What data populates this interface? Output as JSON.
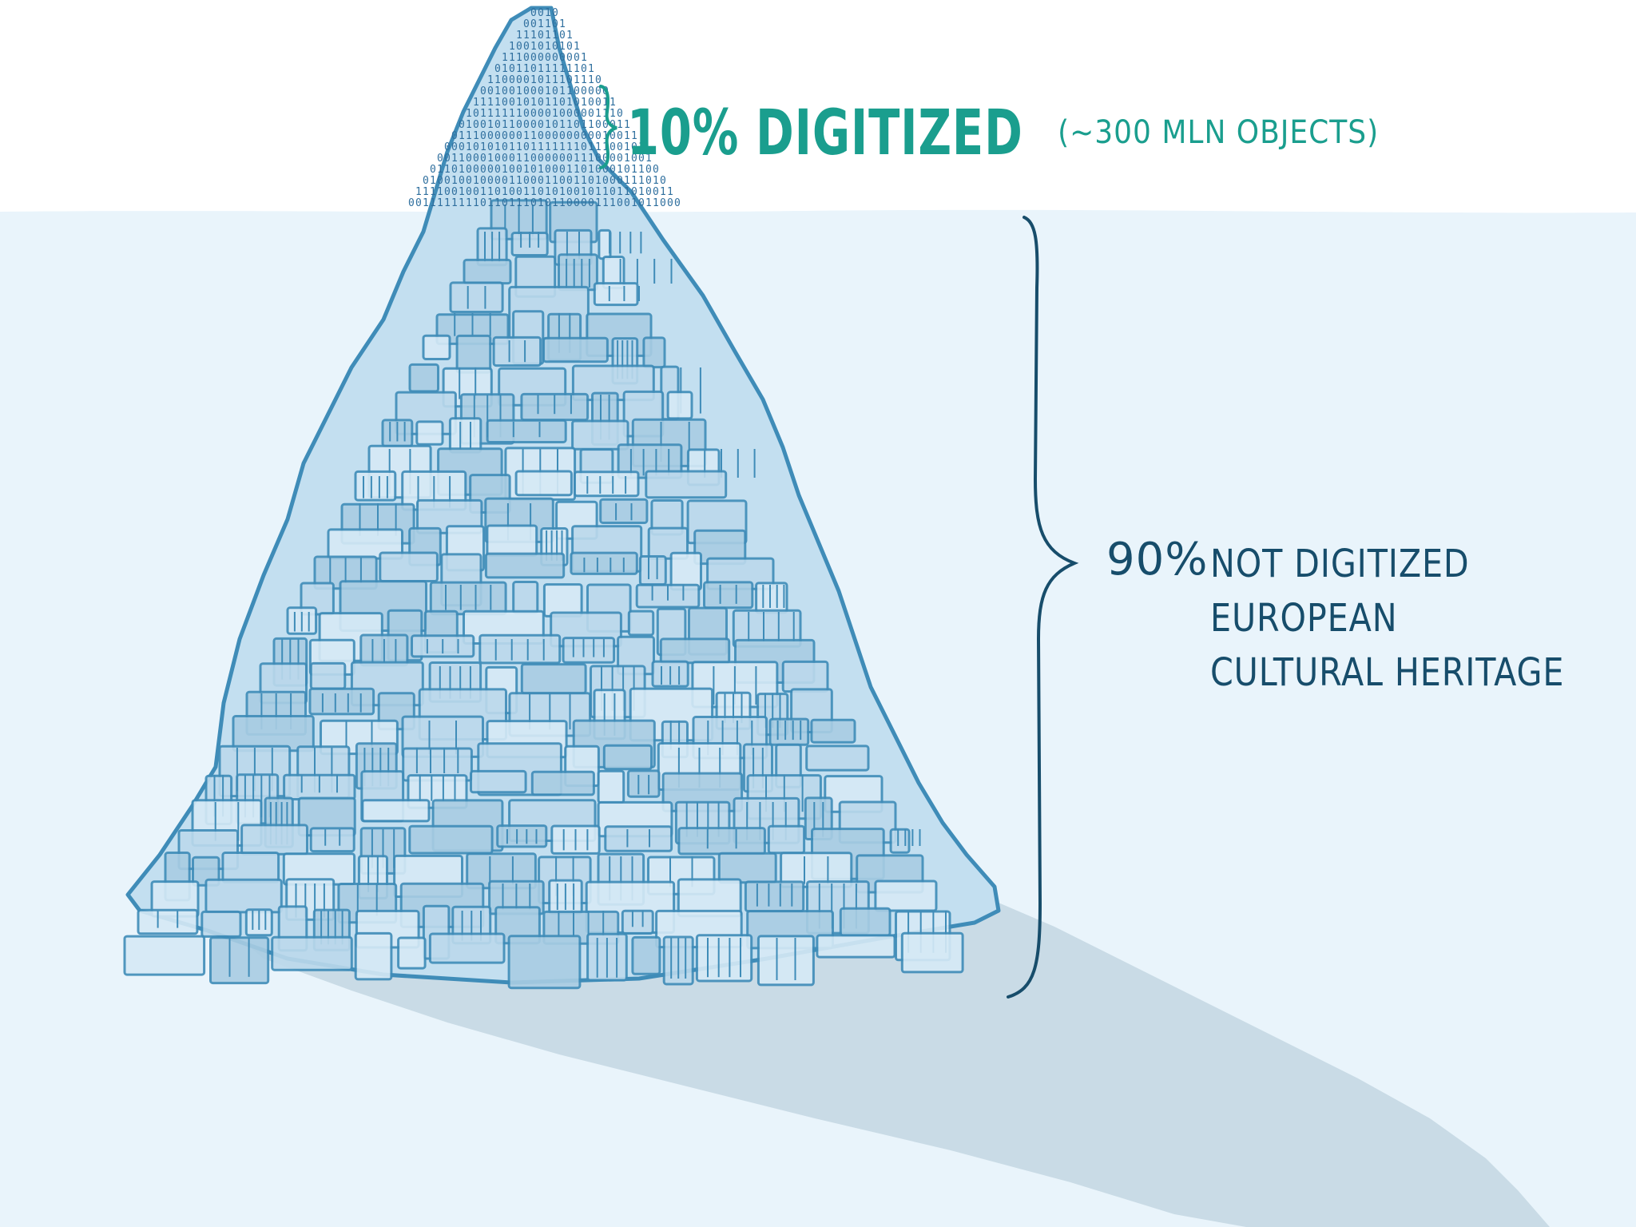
{
  "top_label": {
    "percent_text": "10% DIGITIZED",
    "detail_text": "(~300 MLN OBJECTS)"
  },
  "right_label": {
    "percent_text": "90%",
    "line1": "NOT DIGITIZED",
    "line2": "EUROPEAN",
    "line3": "CULTURAL HERITAGE"
  },
  "icons": {
    "binary_digits": "0 1",
    "pyramid": "pyramid-of-objects-icon"
  },
  "colors": {
    "sky": "#ffffff",
    "water": "#e9f4fb",
    "shadow": "#c9dbe6",
    "pyramid_fill": "#c3dff0",
    "pyramid_line": "#3f8cb8",
    "tip_digits": "#2f6f9e",
    "accent_teal": "#1a9e8e",
    "brace_dark": "#174d6b"
  }
}
